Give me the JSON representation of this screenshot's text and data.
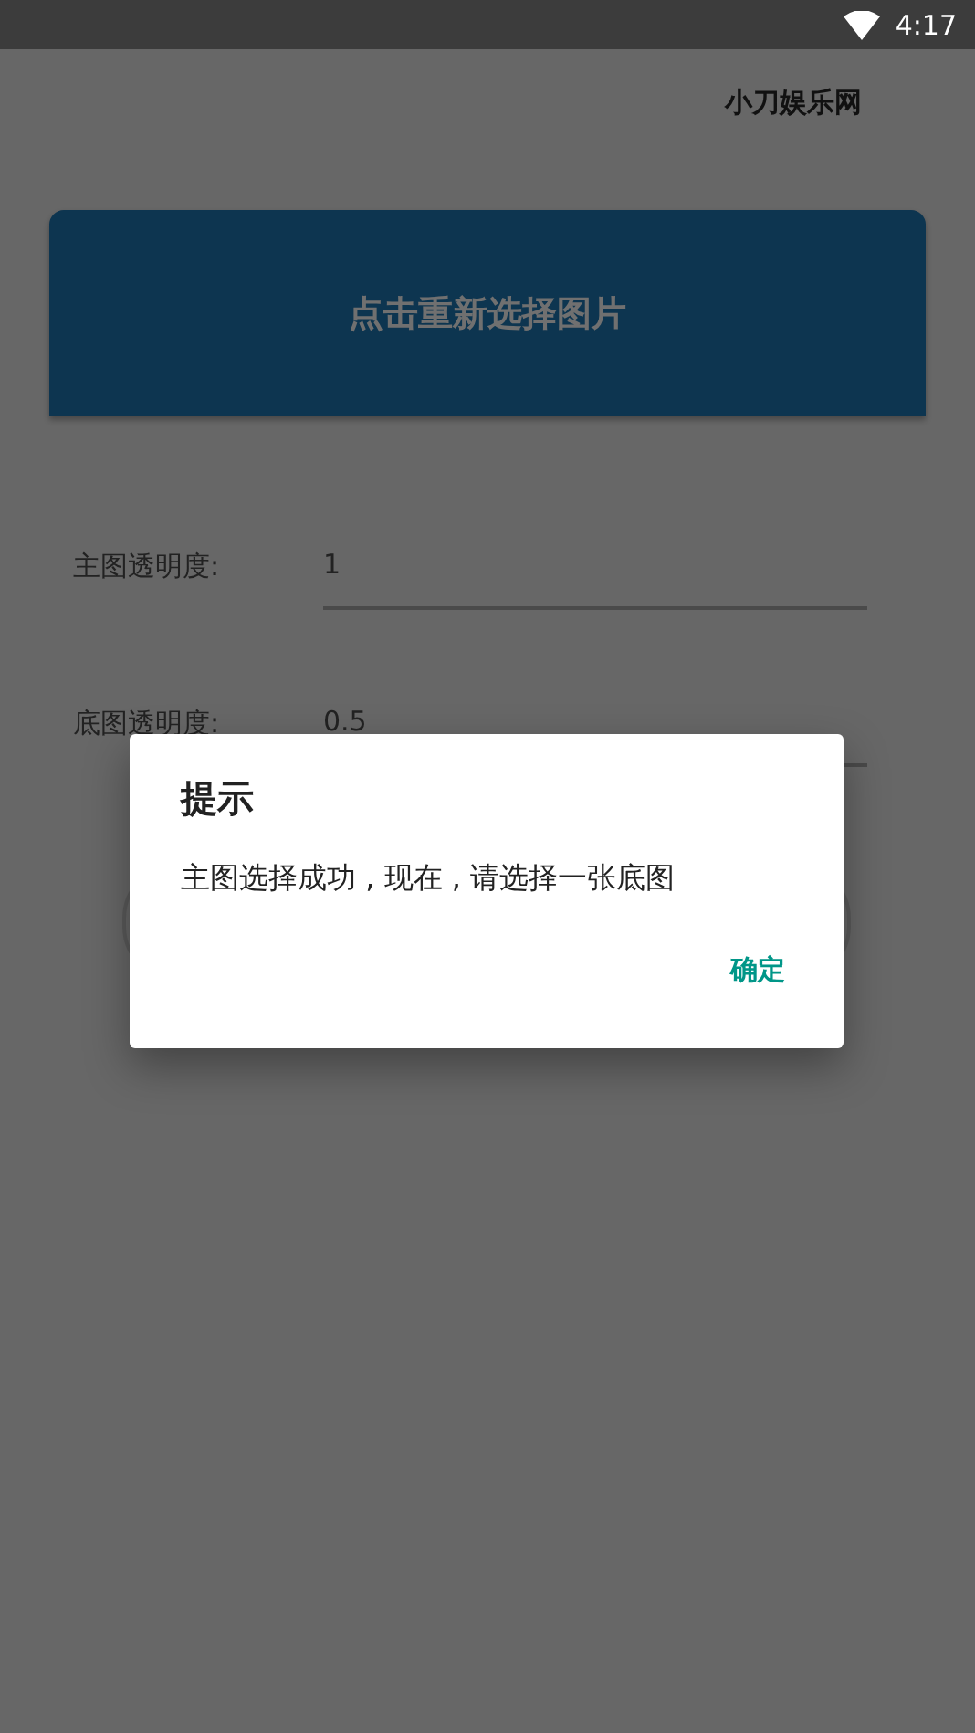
{
  "status_bar": {
    "time": "4:17"
  },
  "header": {
    "title": "小刀娱乐网"
  },
  "image_button": {
    "label": "点击重新选择图片"
  },
  "fields": [
    {
      "label": "主图透明度:",
      "value": "1"
    },
    {
      "label": "底图透明度:",
      "value": "0.5"
    }
  ],
  "dialog": {
    "title": "提示",
    "message": "主图选择成功 , 现在 , 请选择一张底图",
    "buttons": [
      "确定"
    ]
  }
}
